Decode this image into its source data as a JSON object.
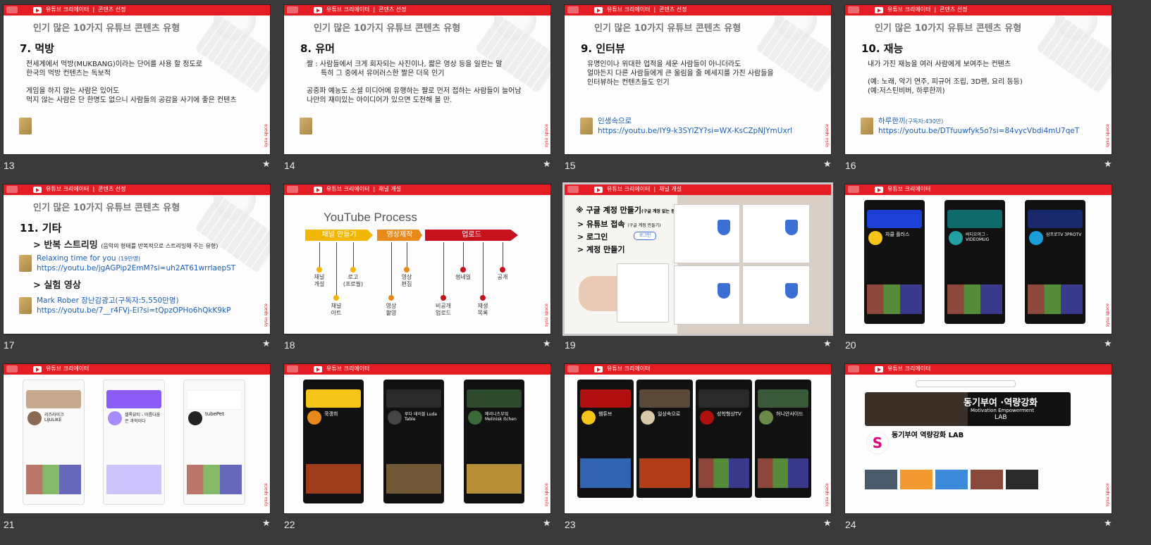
{
  "slides": [
    {
      "num": "13",
      "breadcrumb": [
        "유튜브 크리에이터",
        "콘텐츠 선정"
      ],
      "subtitle": "인기 많은 10가지 유튜브 콘텐츠 유형",
      "heading": "7. 먹방",
      "lines": [
        "전세계에서 먹방(MUKBANG)이라는 단어를 사용 할 정도로",
        "한국의 먹방 컨텐츠는 독보적",
        "",
        "게임을 하지 않는 사람은 있어도",
        "먹지 않는 사람은 단 한명도 없으니 사람들의 공감을 사기에 좋은 컨텐츠"
      ]
    },
    {
      "num": "14",
      "breadcrumb": [
        "유튜브 크리에이터",
        "콘텐츠 선정"
      ],
      "subtitle": "인기 많은 10가지 유튜브 콘텐츠 유형",
      "heading": "8. 유머",
      "lines": [
        "짤 : 사람들에서 크게 회자되는 사진이나, 짧은 영상 등을 일컫는 말",
        "     특히 그 중에서 유머러스한 짤은 더욱 인기",
        "",
        "공중파 예능도 소셜 미디어에 유행하는 짤로 먼저 접하는 사람들이 늘어남",
        "나만의 재미있는 아이디어가 있으면 도전해 볼 만."
      ]
    },
    {
      "num": "15",
      "breadcrumb": [
        "유튜브 크리에이터",
        "콘텐츠 선정"
      ],
      "subtitle": "인기 많은 10가지 유튜브 콘텐츠 유형",
      "heading": "9. 인터뷰",
      "lines": [
        "유명인이나 위대한 업적을 세운 사람들이 아니더라도",
        "얼마든지 다른 사람들에게 큰 울림을 줄 메세지를 가진 사람들을",
        "인터뷰하는 컨텐츠들도 인기"
      ],
      "link_title": "인생속으로",
      "link_note": "",
      "link_url": "https://youtu.be/IY9-k3SYlZY?si=WX-KsCZpNJYmUxrl"
    },
    {
      "num": "16",
      "breadcrumb": [
        "유튜브 크리에이터",
        "콘텐츠 선정"
      ],
      "subtitle": "인기 많은 10가지 유튜브 콘텐츠 유형",
      "heading": "10. 재능",
      "lines": [
        "내가 가진 재능을 여러 사람에게 보여주는 컨텐츠",
        "",
        "(예: 노래, 악기 연주, 피규어 조립, 3D펜, 요리 등등)",
        "(예:저스틴비버, 하루한끼)"
      ],
      "link_title": "하루한끼",
      "link_note": "(구독자:430만)",
      "link_url": "https://youtu.be/DTfuuwfyk5o?si=84vycVbdi4mU7qeT"
    },
    {
      "num": "17",
      "breadcrumb": [
        "유튜브 크리에이터",
        "콘텐츠 선정"
      ],
      "subtitle": "인기 많은 10가지 유튜브 콘텐츠 유형",
      "heading": "11. 기타",
      "sec1": "> 반복 스트리밍",
      "sec1_note": "(음악의 형태를 반복적으로 스트리밍해 주는 유형)",
      "l1_title": "Relaxing time for you",
      "l1_note": "(19만명)",
      "l1_url": "https://youtu.be/jgAGPip2EmM?si=uh2AT61wrrlaepST",
      "sec2": "> 실험 영상",
      "l2_title": "Mark Rober 장난감광고(구독자:5,550만명)",
      "l2_url": "https://youtu.be/7__r4FVj-EI?si=tQpzOPHo6hQkK9kP"
    },
    {
      "num": "18",
      "breadcrumb": [
        "유튜브 크리에이터",
        "채널 개설"
      ],
      "title": "YouTube  Process",
      "stages": [
        "채널 만들기",
        "영상제작",
        "업로드"
      ],
      "steps": [
        "채널\n개설",
        "채널\n아트",
        "로고\n(프로필)",
        "영상\n촬영",
        "영상\n편집",
        "비공개\n업로드",
        "썸네일",
        "재생\n목록",
        "공개"
      ]
    },
    {
      "num": "19",
      "breadcrumb": [
        "유튜브 크리에이터",
        "채널 개설"
      ],
      "google_heading": "※ 구글 계정 만들기",
      "google_note": "(구글 계정 없는 분만)",
      "items": [
        "> 유튜브 접속",
        "> 로그인",
        "> 계정 만들기"
      ],
      "item_note": "(구글 계정 만들기)",
      "login_btn": "로그인"
    },
    {
      "num": "20",
      "breadcrumb": [
        "유튜브 크리에이터"
      ],
      "channels": [
        "차클 플러스",
        "비디오머그 - VIDEOMUG",
        "삼프로TV 3PROTV"
      ]
    },
    {
      "num": "21",
      "breadcrumb": [
        "유튜브 크리에이터"
      ],
      "channels": [
        "리즈라이크 LIJULIKE",
        "셀록뷰티 - 아름다움은 과학이다",
        "tubePet"
      ]
    },
    {
      "num": "22",
      "breadcrumb": [
        "유튜브 크리에이터"
      ],
      "channels": [
        "쿡갱희",
        "루다 테이블 Luda Table",
        "메리니츠부엌Melinisk itchen"
      ]
    },
    {
      "num": "23",
      "breadcrumb": [
        "유튜브 크리에이터"
      ],
      "channels": [
        "햄튜브",
        "일상속으로",
        "성학형상TV",
        "허니안사이드"
      ]
    },
    {
      "num": "24",
      "breadcrumb": [
        "유튜브 크리에이터"
      ],
      "banner_title": "동기부여 ·역량강화",
      "banner_sub": "Motivation Empowerment",
      "banner_lab": "LAB",
      "channel_name": "동기부여 역량강화 LAB"
    }
  ],
  "star": "★",
  "side_text": "sysu space"
}
